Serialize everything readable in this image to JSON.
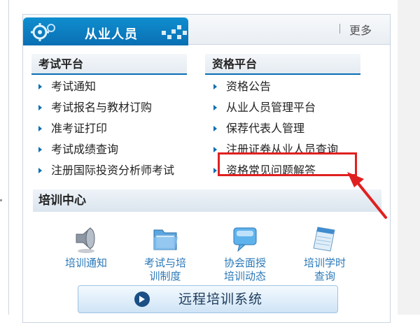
{
  "header": {
    "tab_title": "从业人员",
    "more_label": "更多"
  },
  "exam_platform": {
    "title": "考试平台",
    "items": [
      {
        "label": "考试通知"
      },
      {
        "label": "考试报名与教材订购"
      },
      {
        "label": "准考证打印"
      },
      {
        "label": "考试成绩查询"
      },
      {
        "label": "注册国际投资分析师考试"
      }
    ]
  },
  "qualification_platform": {
    "title": "资格平台",
    "items": [
      {
        "label": "资格公告"
      },
      {
        "label": "从业人员管理平台"
      },
      {
        "label": "保荐代表人管理"
      },
      {
        "label": "注册证券从业人员查询"
      },
      {
        "label": "资格常见问题解答"
      }
    ]
  },
  "training_center": {
    "title": "培训中心",
    "items": [
      {
        "label": "培训通知",
        "icon": "speaker-icon"
      },
      {
        "label": "考试与培\n训制度",
        "icon": "folder-icon"
      },
      {
        "label": "协会面授\n培训动态",
        "icon": "chat-bubble-icon"
      },
      {
        "label": "培训学时\n查询",
        "icon": "notepad-icon"
      }
    ],
    "remote_system": "远程培训系统"
  },
  "colors": {
    "accent": "#0a6fb3",
    "link": "#2a78b8",
    "highlight": "#e02020"
  }
}
